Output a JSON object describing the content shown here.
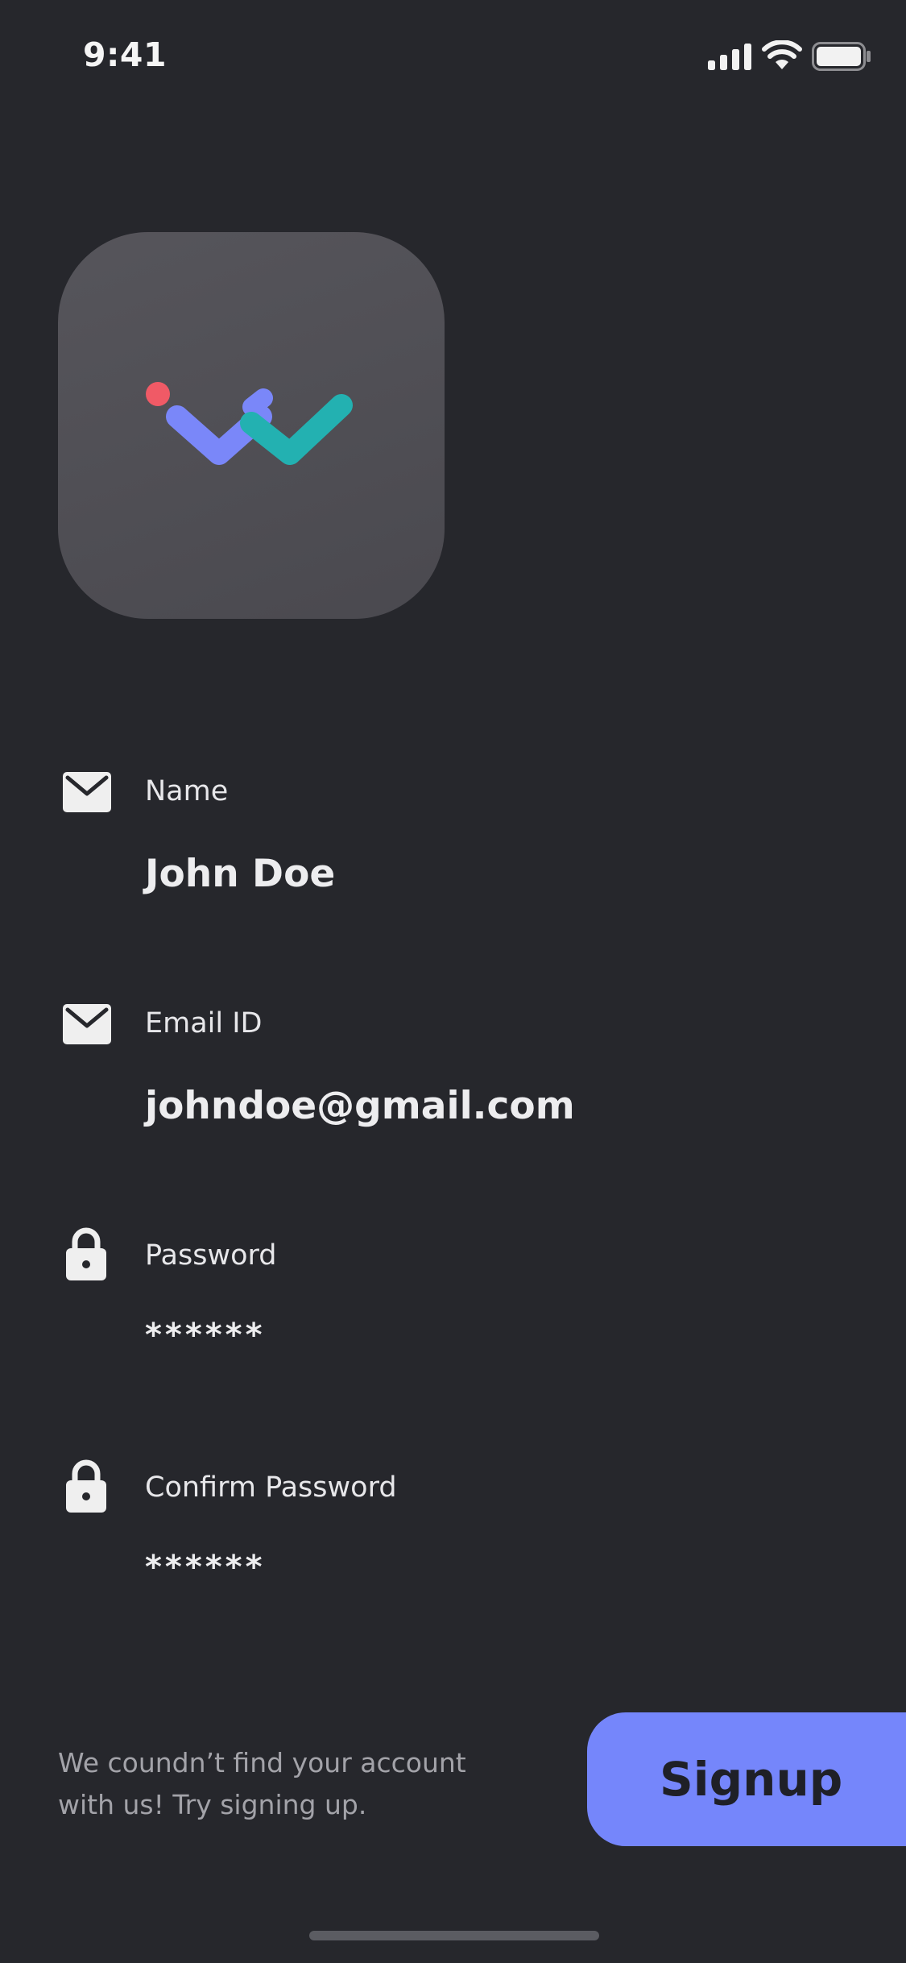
{
  "status_bar": {
    "time": "9:41",
    "icons": [
      "signal-icon",
      "wifi-icon",
      "battery-icon"
    ]
  },
  "logo": {
    "icon": "app-logo-icon",
    "colors": {
      "tile": "#4f4e54",
      "dot": "#f05a66",
      "left_check": "#7a87f9",
      "right_check": "#23b1b1"
    }
  },
  "form": {
    "name": {
      "label": "Name",
      "value": "John Doe",
      "icon": "mail-icon"
    },
    "email": {
      "label": "Email ID",
      "value": "johndoe@gmail.com",
      "icon": "mail-icon"
    },
    "password": {
      "label": "Password",
      "value": "******",
      "icon": "lock-icon"
    },
    "confirm_password": {
      "label": "Confirm Password",
      "value": "******",
      "icon": "lock-icon"
    }
  },
  "footer": {
    "message": "We coundn’t find your account with us! Try signing up.",
    "signup_label": "Signup"
  },
  "colors": {
    "background": "#26272c",
    "accent": "#7586fb"
  }
}
